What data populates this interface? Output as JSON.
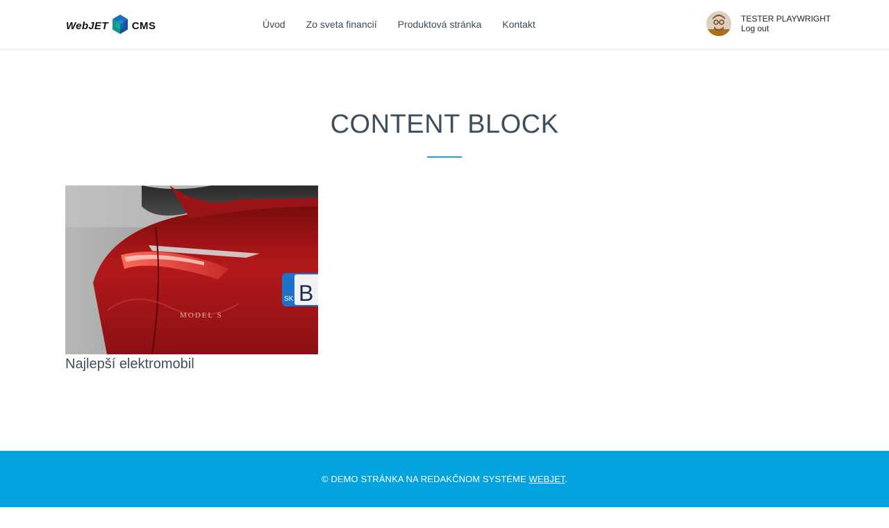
{
  "header": {
    "logo": {
      "left_text": "WebJET",
      "right_text": "CMS",
      "icon": "webjet-cube-icon"
    },
    "nav": [
      {
        "label": "Úvod"
      },
      {
        "label": "Zo sveta financií"
      },
      {
        "label": "Produktová stránka"
      },
      {
        "label": "Kontakt"
      }
    ],
    "user": {
      "name": "TESTER PLAYWRIGHT",
      "logout_label": "Log out",
      "avatar_icon": "user-avatar-icon"
    }
  },
  "main": {
    "title": "CONTENT BLOCK",
    "cards": [
      {
        "title": "Najlepší elektromobil",
        "image": {
          "icon": "red-car-photo",
          "badge_prefix": "SK",
          "badge_letter": "B",
          "model_text": "MODEL S"
        }
      }
    ]
  },
  "footer": {
    "prefix": "© DEMO STRÁNKA NA REDAKČNOM SYSTÉME ",
    "link": "WEBJET",
    "suffix": "."
  },
  "colors": {
    "accent": "#03a3df",
    "rule": "#1aa3dc",
    "title_text": "#3d4f5c",
    "nav_text": "#3d4a55",
    "footer_bg": "#03a3df"
  }
}
